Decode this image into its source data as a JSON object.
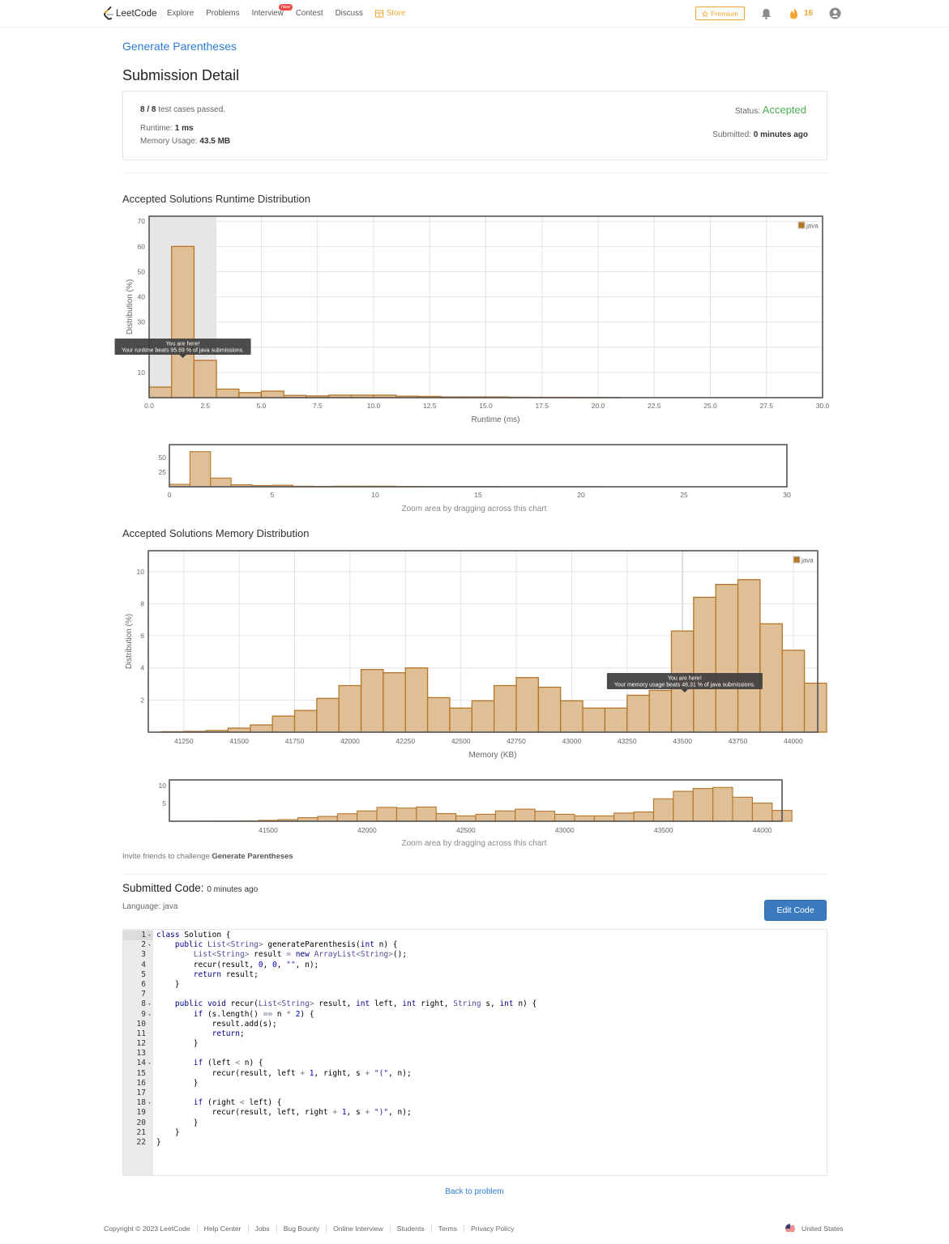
{
  "nav": {
    "logo": "LeetCode",
    "links": [
      "Explore",
      "Problems",
      "Interview",
      "Contest",
      "Discuss"
    ],
    "store": "Store",
    "new_badge": "New",
    "premium": "Premium",
    "streak": "16"
  },
  "problem": {
    "title": "Generate Parentheses"
  },
  "page_title": "Submission Detail",
  "summary": {
    "passed": "8 / 8",
    "passed_suffix": " test cases passed.",
    "runtime_label": "Runtime: ",
    "runtime": "1 ms",
    "memory_label": "Memory Usage: ",
    "memory": "43.5 MB",
    "status_label": "Status: ",
    "status": "Accepted",
    "submitted_label": "Submitted: ",
    "submitted": "0 minutes ago"
  },
  "runtime_section": {
    "title": "Accepted Solutions Runtime Distribution",
    "zoom_hint": "Zoom area by dragging across this chart"
  },
  "memory_section": {
    "title": "Accepted Solutions Memory Distribution",
    "zoom_hint": "Zoom area by dragging across this chart"
  },
  "chart_data": [
    {
      "type": "bar",
      "title": "Accepted Solutions Runtime Distribution",
      "xlabel": "Runtime (ms)",
      "ylabel": "Distribution (%)",
      "xlim": [
        0,
        30
      ],
      "ylim": [
        0,
        72
      ],
      "xticks": [
        "0.0",
        "2.5",
        "5.0",
        "7.5",
        "10.0",
        "12.5",
        "15.0",
        "17.5",
        "20.0",
        "22.5",
        "25.0",
        "27.5",
        "30.0"
      ],
      "xtick_values": [
        0,
        2.5,
        5,
        7.5,
        10,
        12.5,
        15,
        17.5,
        20,
        22.5,
        25,
        27.5,
        30
      ],
      "yticks": [
        10,
        20,
        30,
        40,
        50,
        60,
        70
      ],
      "bin_width": 1,
      "x": [
        0,
        1,
        2,
        3,
        4,
        5,
        6,
        7,
        8,
        9,
        10,
        11,
        12,
        13,
        14,
        15,
        16,
        17,
        18,
        19,
        20
      ],
      "values": [
        4.2,
        60.0,
        14.8,
        3.4,
        2.0,
        2.6,
        0.9,
        0.7,
        1.0,
        1.0,
        1.0,
        0.6,
        0.5,
        0.3,
        0.3,
        0.3,
        0.2,
        0.15,
        0.15,
        0.12,
        0.1
      ],
      "legend": "java",
      "legend_position": "top-right",
      "highlight_range": [
        0,
        3
      ],
      "tooltip": [
        "You are here!",
        "Your runtime beats 95.69 % of java submissions."
      ],
      "tooltip_x": 1.5,
      "zoom_ticks": [
        "0",
        "5",
        "10",
        "15",
        "20",
        "25",
        "30"
      ],
      "zoom_tick_values": [
        0,
        5,
        10,
        15,
        20,
        25,
        30
      ],
      "zoom_yticks": [
        25,
        50
      ]
    },
    {
      "type": "bar",
      "title": "Accepted Solutions Memory Distribution",
      "xlabel": "Memory (KB)",
      "ylabel": "Distribution (%)",
      "xlim": [
        41090,
        44110
      ],
      "ylim": [
        0,
        11.3
      ],
      "xticks": [
        "41250",
        "41500",
        "41750",
        "42000",
        "42250",
        "42500",
        "42750",
        "43000",
        "43250",
        "43500",
        "43750",
        "44000"
      ],
      "xtick_values": [
        41250,
        41500,
        41750,
        42000,
        42250,
        42500,
        42750,
        43000,
        43250,
        43500,
        43750,
        44000
      ],
      "yticks": [
        2,
        4,
        6,
        8,
        10
      ],
      "bin_width": 100,
      "x": [
        41150,
        41250,
        41350,
        41450,
        41550,
        41650,
        41750,
        41850,
        41950,
        42050,
        42150,
        42250,
        42350,
        42450,
        42550,
        42650,
        42750,
        42850,
        42950,
        43050,
        43150,
        43250,
        43350,
        43450,
        43550,
        43650,
        43750,
        43850,
        43950,
        44050
      ],
      "values": [
        0.03,
        0.05,
        0.1,
        0.25,
        0.45,
        1.0,
        1.35,
        2.1,
        2.9,
        3.9,
        3.7,
        4.0,
        2.15,
        1.5,
        1.95,
        2.9,
        3.4,
        2.8,
        1.95,
        1.5,
        1.5,
        2.3,
        2.6,
        6.3,
        8.4,
        9.2,
        9.5,
        6.75,
        5.1,
        3.05
      ],
      "legend": "java",
      "legend_position": "top-right",
      "highlight_x": 43500,
      "tooltip": [
        "You are here!",
        "Your memory usage beats 48.31 % of java submissions."
      ],
      "tooltip_x": 43510,
      "zoom_ticks": [
        "41500",
        "42000",
        "42500",
        "43000",
        "43500",
        "44000"
      ],
      "zoom_tick_values": [
        41500,
        42000,
        42500,
        43000,
        43500,
        44000
      ],
      "zoom_yticks": [
        5,
        10
      ]
    }
  ],
  "invite": {
    "prefix": "Invite friends to challenge ",
    "problem": "Generate Parentheses"
  },
  "code": {
    "title": "Submitted Code:",
    "time": "0 minutes ago",
    "language": "Language: java",
    "edit_button": "Edit Code",
    "lines": [
      "class Solution {",
      "    public List<String> generateParenthesis(int n) {",
      "        List<String> result = new ArrayList<String>();",
      "        recur(result, 0, 0, \"\", n);",
      "        return result;",
      "    }",
      "",
      "    public void recur(List<String> result, int left, int right, String s, int n) {",
      "        if (s.length() == n * 2) {",
      "            result.add(s);",
      "            return;",
      "        }",
      "",
      "        if (left < n) {",
      "            recur(result, left + 1, right, s + \"(\", n);",
      "        }",
      "",
      "        if (right < left) {",
      "            recur(result, left, right + 1, s + \")\", n);",
      "        }",
      "    }",
      "}"
    ],
    "fold_lines": [
      1,
      2,
      8,
      9,
      14,
      18
    ]
  },
  "back_link": "Back to problem",
  "footer": {
    "copyright": "Copyright © 2023 LeetCode",
    "links": [
      "Help Center",
      "Jobs",
      "Bug Bounty",
      "Online Interview",
      "Students",
      "Terms",
      "Privacy Policy"
    ],
    "country": "United States"
  },
  "colors": {
    "accent": "#2a7bd3",
    "accepted": "#4caf50",
    "premium": "#f0a630",
    "bar_fill": "#deBf96",
    "bar_stroke": "#b5762a",
    "button": "#3a7bbf"
  }
}
